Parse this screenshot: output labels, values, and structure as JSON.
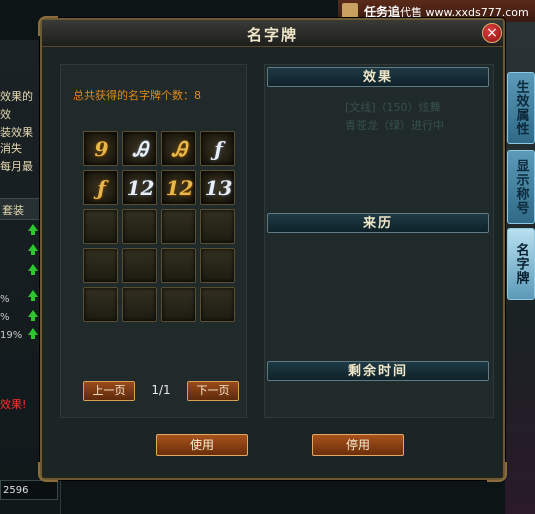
{
  "background": {
    "left_lines": [
      "效果的",
      "效",
      "装效果",
      "消失",
      "每月最"
    ],
    "left_header": "套装",
    "left_percents": [
      "%",
      "%",
      "19%"
    ],
    "left_red": "效果!",
    "left_bottom_value": "2596",
    "top_banner": "任务追",
    "watermark": "代售 www.xxds777.com"
  },
  "side_tabs": [
    {
      "label": "生效属性"
    },
    {
      "label": "显示称号"
    },
    {
      "label": "名字牌"
    }
  ],
  "panel": {
    "title": "名字牌",
    "close_label": "×",
    "total_text": "总共获得的名字牌个数：8",
    "badges": [
      {
        "glyph": "9",
        "style": "gold",
        "icon": "gold-rune-badge-icon"
      },
      {
        "glyph": "Ꭿ",
        "style": "silver",
        "icon": "silver-rune-badge-icon"
      },
      {
        "glyph": "Ꭿ",
        "style": "gold",
        "icon": "gold-rune-badge-icon"
      },
      {
        "glyph": "ƒ",
        "style": "silver",
        "icon": "silver-rune-badge-icon"
      },
      {
        "glyph": "ƒ",
        "style": "gold",
        "icon": "gold-rune-badge-icon"
      },
      {
        "glyph": "12",
        "style": "silver",
        "icon": "silver-number-badge-icon"
      },
      {
        "glyph": "12",
        "style": "gold",
        "icon": "gold-number-badge-icon"
      },
      {
        "glyph": "13",
        "style": "silver",
        "icon": "silver-number-badge-icon"
      }
    ],
    "empty_slots": 12,
    "prev_page": "上一页",
    "page_indicator": "1/1",
    "next_page": "下一页",
    "effect_header": "效果",
    "origin_header": "来历",
    "time_header": "剩余时间",
    "ghost_lines": [
      "[文线]（150）炫舞",
      "青苍龙（绿）进行中"
    ],
    "use_label": "使用",
    "stop_label": "停用"
  }
}
